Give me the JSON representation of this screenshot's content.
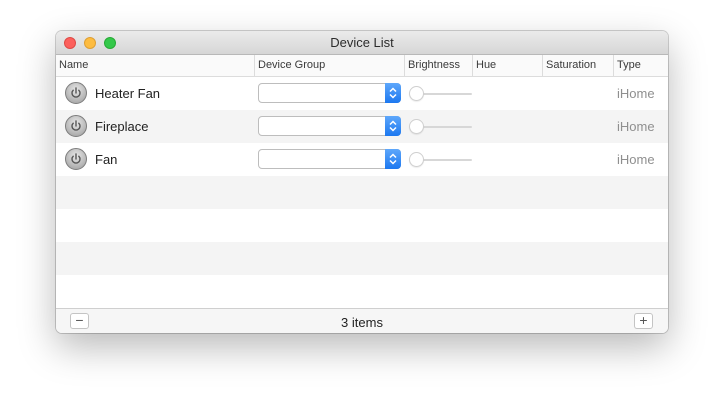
{
  "window": {
    "title": "Device List"
  },
  "columns": [
    {
      "label": "Name"
    },
    {
      "label": "Device Group"
    },
    {
      "label": "Brightness"
    },
    {
      "label": "Hue"
    },
    {
      "label": "Saturation"
    },
    {
      "label": "Type"
    }
  ],
  "devices": [
    {
      "name": "Heater Fan",
      "group": "",
      "brightness": 0,
      "type": "iHome",
      "icon": "power-icon"
    },
    {
      "name": "Fireplace",
      "group": "",
      "brightness": 0,
      "type": "iHome",
      "icon": "power-icon"
    },
    {
      "name": "Fan",
      "group": "",
      "brightness": 0,
      "type": "iHome",
      "icon": "power-icon"
    }
  ],
  "footer": {
    "count_text": "3 items",
    "remove_label": "−",
    "add_label": "+"
  },
  "colors": {
    "accent": "#1c78f0",
    "close": "#fc605c",
    "minimize": "#fdbc40",
    "maximize": "#34c84a"
  }
}
